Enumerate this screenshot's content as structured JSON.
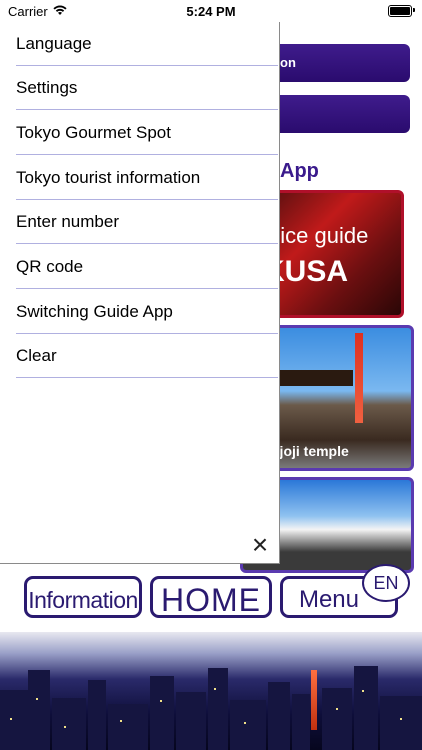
{
  "status": {
    "carrier": "Carrier",
    "time": "5:24 PM"
  },
  "drawer": {
    "items": [
      {
        "label": "Language"
      },
      {
        "label": "Settings"
      },
      {
        "label": "Tokyo Gourmet Spot"
      },
      {
        "label": "Tokyo tourist information"
      },
      {
        "label": "Enter number"
      },
      {
        "label": "QR code"
      },
      {
        "label": "Switching Guide App"
      },
      {
        "label": "Clear"
      }
    ],
    "close_symbol": "×"
  },
  "background": {
    "button1_text": "on",
    "section_title": "App",
    "asakusa_line1": "oice guide",
    "asakusa_line2": "KUSA",
    "temple_label": "ojoji temple"
  },
  "bottom_nav": {
    "information": "Information",
    "home": "HOME",
    "menu": "Menu",
    "language_badge": "EN"
  },
  "colors": {
    "accent": "#2a1a70",
    "menu_divider": "#b0b0e0"
  }
}
